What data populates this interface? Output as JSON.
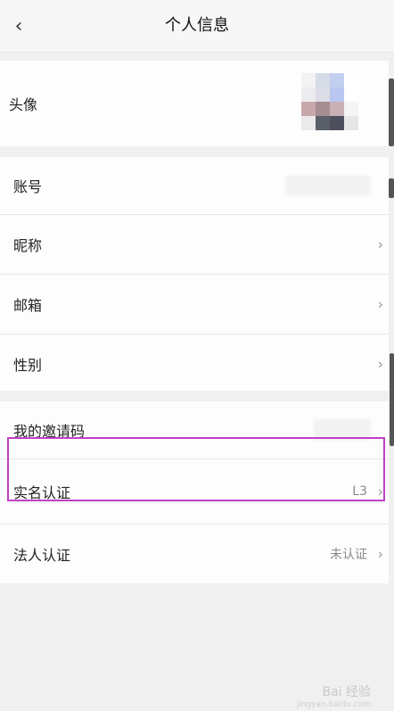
{
  "header": {
    "title": "个人信息",
    "back_icon": "chevron-left-icon"
  },
  "profile": {
    "avatar_label": "头像",
    "account_label": "账号",
    "nickname_label": "昵称",
    "email_label": "邮箱",
    "gender_label": "性别"
  },
  "extra": {
    "invite_label": "我的邀请码",
    "realname_label": "实名认证",
    "realname_value": "L3",
    "legal_label": "法人认证",
    "legal_value": "未认证"
  },
  "watermark": {
    "text": "Bai 经验",
    "sub": "jingyan.baidu.com"
  },
  "colors": {
    "highlight": "#c040c8"
  }
}
